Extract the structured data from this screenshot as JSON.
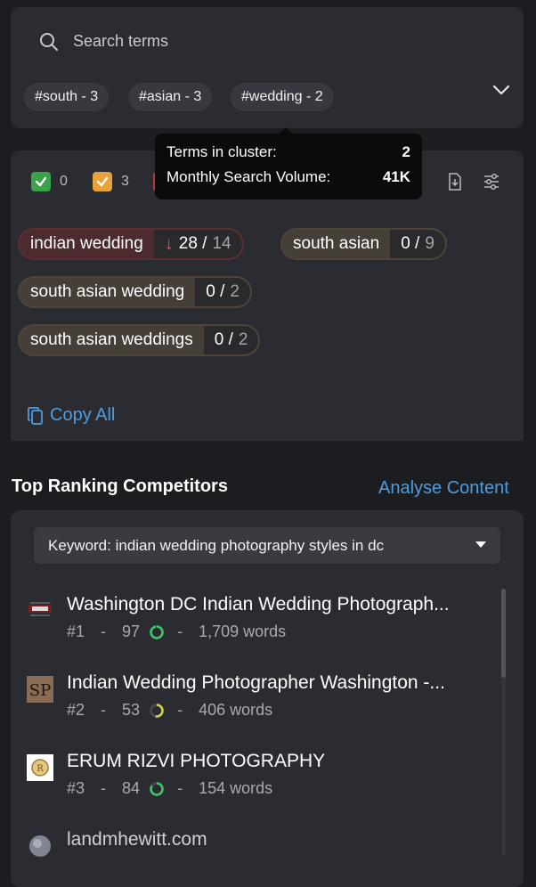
{
  "search": {
    "placeholder": "Search terms"
  },
  "chips": [
    {
      "tag": "#south",
      "count": "3"
    },
    {
      "tag": "#asian",
      "count": "3"
    },
    {
      "tag": "#wedding",
      "count": "2"
    }
  ],
  "tooltip": {
    "terms_label": "Terms in cluster:",
    "terms_value": "2",
    "volume_label": "Monthly Search Volume:",
    "volume_value": "41K"
  },
  "counts": {
    "green": "0",
    "orange": "3"
  },
  "terms": [
    {
      "name": "indian wedding",
      "current": "28",
      "total": "14",
      "trend": "down",
      "color": "#e05a5a"
    },
    {
      "name": "south asian",
      "current": "0",
      "total": "9"
    },
    {
      "name": "south asian wedding",
      "current": "0",
      "total": "2"
    },
    {
      "name": "south asian weddings",
      "current": "0",
      "total": "2"
    }
  ],
  "copy_all": "Copy All",
  "competitors_section": {
    "title": "Top Ranking Competitors",
    "analyse_link": "Analyse Content",
    "keyword_select": "Keyword: indian wedding photography styles in dc",
    "items": [
      {
        "title": "Washington DC Indian Wedding Photograph...",
        "rank": "#1",
        "score": "97",
        "score_pct": 97,
        "words": "1,709 words",
        "ring_color": "#3ec46d"
      },
      {
        "title": "Indian Wedding Photographer Washington -...",
        "rank": "#2",
        "score": "53",
        "score_pct": 53,
        "words": "406 words",
        "ring_color": "#d6d04a"
      },
      {
        "title": "ERUM RIZVI PHOTOGRAPHY",
        "rank": "#3",
        "score": "84",
        "score_pct": 84,
        "words": "154 words",
        "ring_color": "#3ec46d"
      },
      {
        "title": "landmhewitt.com"
      }
    ]
  },
  "colors": {
    "accent": "#4d9de0",
    "background": "#1c1d21",
    "card": "#2b2c31"
  }
}
